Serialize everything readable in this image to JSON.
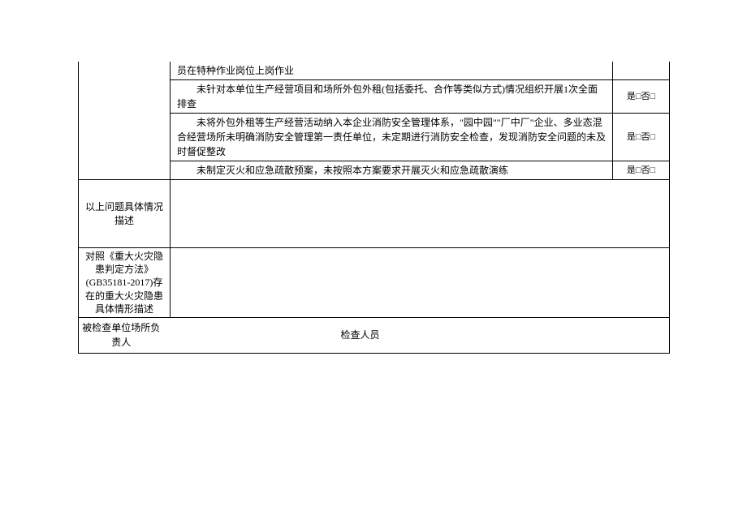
{
  "rows": {
    "r0": {
      "content": "员在特种作业岗位上岗作业"
    },
    "r1": {
      "content": "未针对本单位生产经营项目和场所外包外租(包括委托、合作等类似方式)情况组织开展1次全面排查",
      "check": "是□否□"
    },
    "r2": {
      "content": "未将外包外租等生产经营活动纳入本企业消防安全管理体系，\"园中园\"\"厂中厂\"企业、多业态混合经营场所未明确消防安全管理第一责任单位，未定期进行消防安全检查，发现消防安全问题的未及时督促整改",
      "check": "是□否□"
    },
    "r3": {
      "content": "未制定灭火和应急疏散预案，未按照本方案要求开展灭火和应急疏散演练",
      "check": "是□否□"
    },
    "r4": {
      "label": "以上问题具体情况描述"
    },
    "r5": {
      "label_line1": "对照《重大火灾隐患判定方法》",
      "label_line2": "(GB35181-2017)存在的重大火灾隐患具体情形描述"
    },
    "sig": {
      "left": "被检查单位场所负责人",
      "right": "检查人员"
    }
  }
}
